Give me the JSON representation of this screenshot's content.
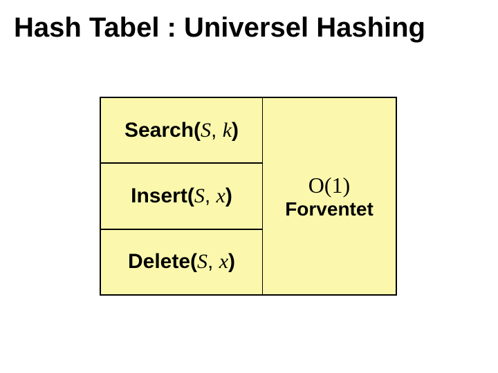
{
  "title": "Hash Tabel : Universel Hashing",
  "ops": {
    "search": {
      "name": "Search",
      "arg1": "S",
      "arg2": "k"
    },
    "insert": {
      "name": "Insert",
      "arg1": "S",
      "arg2": "x"
    },
    "delete": {
      "name": "Delete",
      "arg1": "S",
      "arg2": "x"
    }
  },
  "complexity": {
    "bigO": "O(1)",
    "note": "Forventet"
  }
}
